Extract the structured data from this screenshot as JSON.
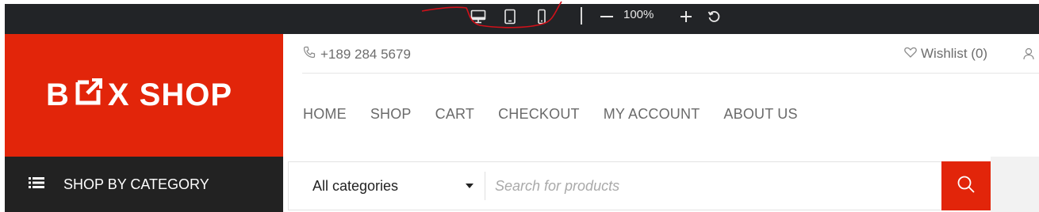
{
  "toolbar": {
    "device_buttons": [
      {
        "icon": "desktop-icon"
      },
      {
        "icon": "tablet-icon"
      },
      {
        "icon": "mobile-icon"
      }
    ],
    "zoom_out_icon": "minus-icon",
    "zoom_level": "100%",
    "zoom_in_icon": "plus-icon",
    "reset_icon": "rotate-ccw-icon",
    "annotation_color": "#d0111a"
  },
  "header": {
    "logo": {
      "left": "B",
      "right": "X SHOP"
    },
    "phone": "+189 284 5679",
    "wishlist": "Wishlist (0)"
  },
  "nav": {
    "items": [
      "HOME",
      "SHOP",
      "CART",
      "CHECKOUT",
      "MY ACCOUNT",
      "ABOUT US"
    ]
  },
  "category": {
    "label": "SHOP BY CATEGORY"
  },
  "search": {
    "selected_category": "All categories",
    "placeholder": "Search for products"
  },
  "colors": {
    "brand": "#e2250a",
    "toolbar_bg": "#222427",
    "category_bg": "#222222",
    "nav_text": "#6a6a6a"
  }
}
